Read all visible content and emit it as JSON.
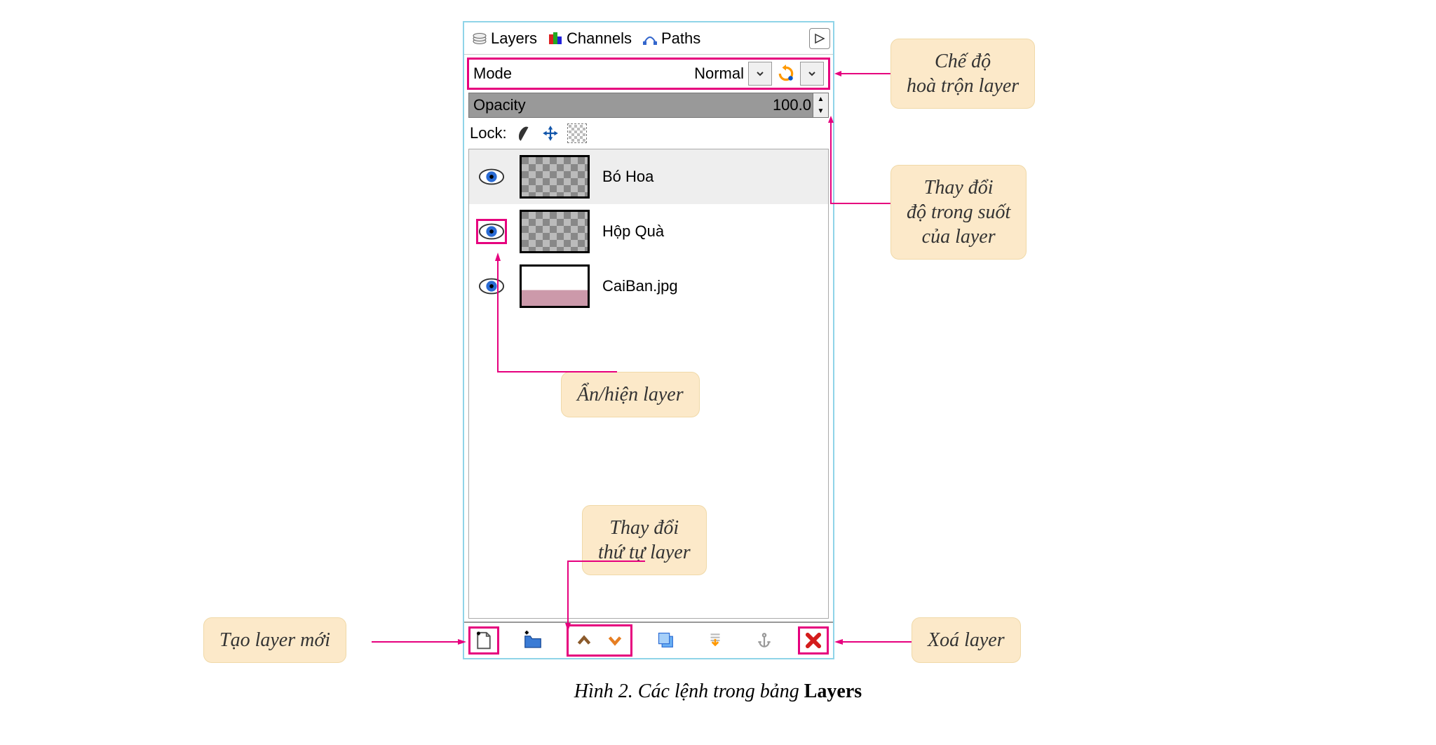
{
  "tabs": {
    "layers": "Layers",
    "channels": "Channels",
    "paths": "Paths"
  },
  "mode": {
    "label": "Mode",
    "value": "Normal"
  },
  "opacity": {
    "label": "Opacity",
    "value": "100.0"
  },
  "lock": {
    "label": "Lock:"
  },
  "layers": [
    {
      "name": "Bó Hoa"
    },
    {
      "name": "Hộp Quà"
    },
    {
      "name": "CaiBan.jpg"
    }
  ],
  "callouts": {
    "mode": "Chế độ\nhoà trộn layer",
    "opacity": "Thay đổi\nđộ trong suốt\ncủa layer",
    "visibility": "Ẩn/hiện layer",
    "order": "Thay đổi\nthứ tự layer",
    "new": "Tạo layer mới",
    "delete": "Xoá layer"
  },
  "caption": {
    "prefix": "Hình 2. Các lệnh trong bảng ",
    "bold": "Layers"
  }
}
